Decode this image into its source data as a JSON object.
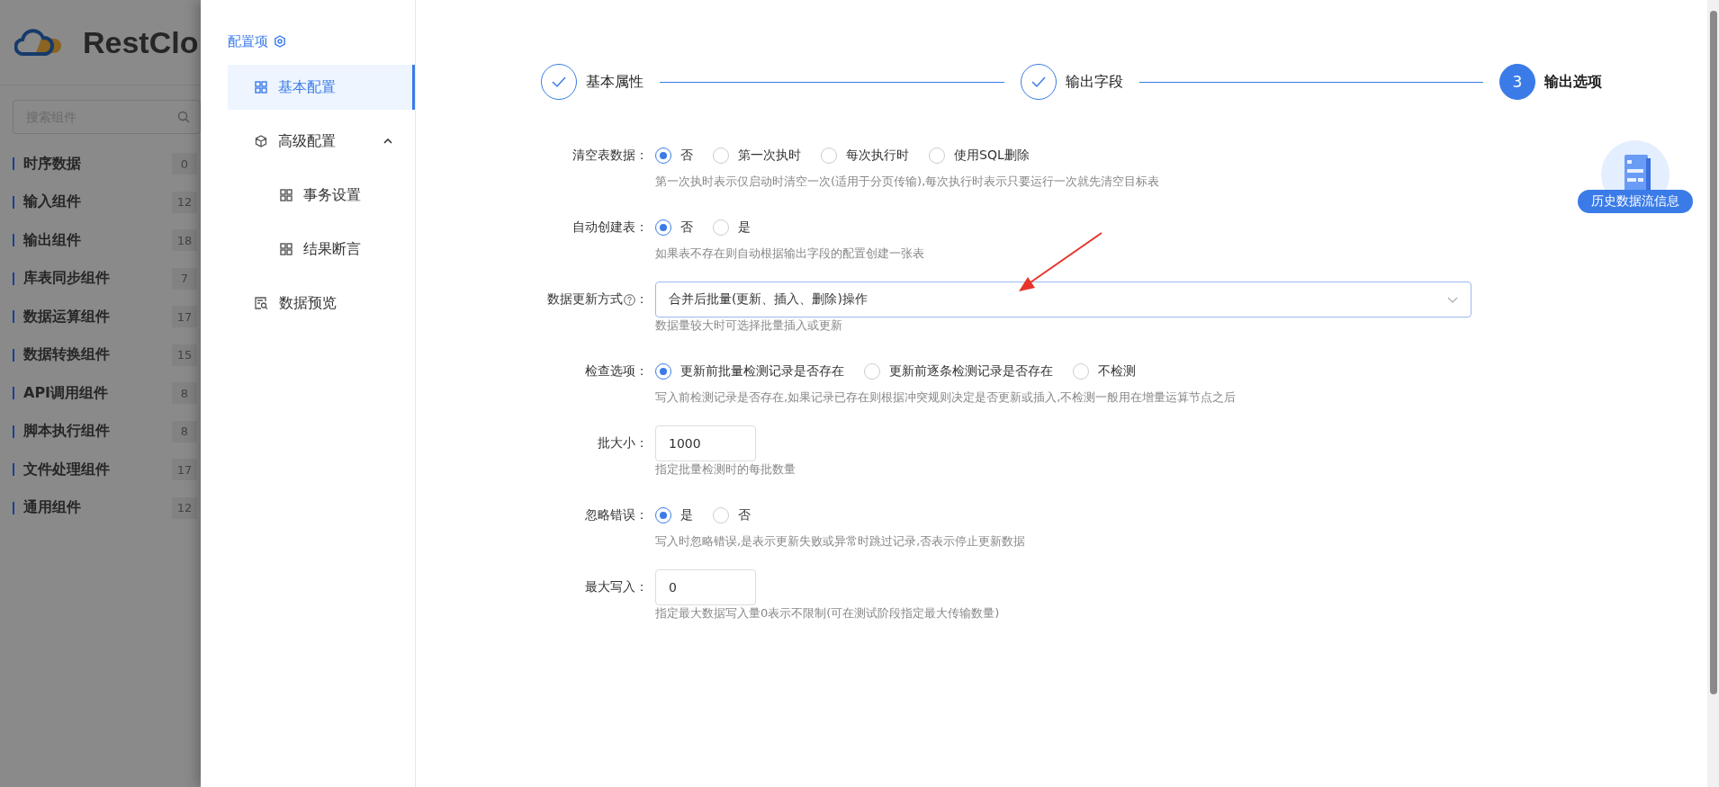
{
  "app": {
    "logo_text": "RestClo",
    "search": {
      "placeholder": "搜索组件"
    },
    "categories": [
      {
        "label": "时序数据",
        "count": "0"
      },
      {
        "label": "输入组件",
        "count": "12"
      },
      {
        "label": "输出组件",
        "count": "18"
      },
      {
        "label": "库表同步组件",
        "count": "7"
      },
      {
        "label": "数据运算组件",
        "count": "17"
      },
      {
        "label": "数据转换组件",
        "count": "15"
      },
      {
        "label": "API调用组件",
        "count": "8"
      },
      {
        "label": "脚本执行组件",
        "count": "8"
      },
      {
        "label": "文件处理组件",
        "count": "17"
      },
      {
        "label": "通用组件",
        "count": "12"
      }
    ]
  },
  "drawer": {
    "nav": {
      "title": "配置项",
      "items": [
        {
          "label": "基本配置",
          "kind": "section",
          "selected": true
        },
        {
          "label": "高级配置",
          "kind": "group",
          "selected": false,
          "expanded": true,
          "children": [
            {
              "label": "事务设置",
              "kind": "section",
              "selected": false
            },
            {
              "label": "结果断言",
              "kind": "section",
              "selected": false
            }
          ]
        },
        {
          "label": "数据预览",
          "kind": "preview",
          "selected": false
        }
      ]
    },
    "steps": [
      {
        "label": "基本属性",
        "completed": true
      },
      {
        "label": "输出字段",
        "completed": true
      },
      {
        "label": "输出选项",
        "completed": false,
        "number": "3"
      }
    ],
    "form": {
      "fields": [
        {
          "kind": "radio",
          "label": "清空表数据",
          "colon": "：",
          "options": [
            {
              "label": "否",
              "selected": true
            },
            {
              "label": "第一次执时",
              "selected": false
            },
            {
              "label": "每次执行时",
              "selected": false
            },
            {
              "label": "使用SQL删除",
              "selected": false
            }
          ],
          "hint": "第一次执时表示仅启动时清空一次(适用于分页传输),每次执行时表示只要运行一次就先清空目标表"
        },
        {
          "kind": "radio",
          "label": "自动创建表",
          "colon": "：",
          "options": [
            {
              "label": "否",
              "selected": true
            },
            {
              "label": "是",
              "selected": false
            }
          ],
          "hint": "如果表不存在则自动根据输出字段的配置创建一张表"
        },
        {
          "kind": "select",
          "label": "数据更新方式",
          "help": true,
          "colon": "：",
          "value": "合并后批量(更新、插入、删除)操作",
          "hint": "数据量较大时可选择批量插入或更新"
        },
        {
          "kind": "radio",
          "label": "检查选项",
          "colon": "：",
          "options": [
            {
              "label": "更新前批量检测记录是否存在",
              "selected": true
            },
            {
              "label": "更新前逐条检测记录是否存在",
              "selected": false
            },
            {
              "label": "不检测",
              "selected": false
            }
          ],
          "hint": "写入前检测记录是否存在,如果记录已存在则根据冲突规则决定是否更新或插入,不检测一般用在增量运算节点之后"
        },
        {
          "kind": "input",
          "label": "批大小",
          "colon": "：",
          "value": "1000",
          "hint": "指定批量检测时的每批数量"
        },
        {
          "kind": "radio",
          "label": "忽略错误",
          "colon": "：",
          "options": [
            {
              "label": "是",
              "selected": true
            },
            {
              "label": "否",
              "selected": false
            }
          ],
          "hint": "写入时忽略错误,是表示更新失败或异常时跳过记录,否表示停止更新数据"
        },
        {
          "kind": "input",
          "label": "最大写入",
          "colon": "：",
          "value": "0",
          "hint": "指定最大数据写入量0表示不限制(可在测试阶段指定最大传输数量)"
        }
      ]
    },
    "history_button": {
      "label": "历史数据流信息"
    }
  }
}
